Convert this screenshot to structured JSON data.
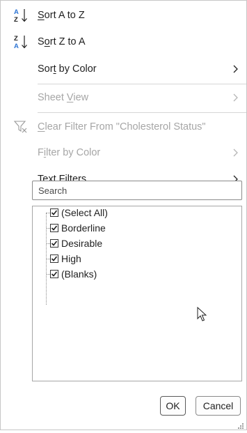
{
  "menu": {
    "sort_az": {
      "pre": "",
      "key": "S",
      "post": "ort A to Z"
    },
    "sort_za": {
      "pre": "S",
      "key": "o",
      "post": "rt Z to A"
    },
    "sort_by_color": {
      "pre": "Sor",
      "key": "t",
      "post": " by Color"
    },
    "sheet_view": {
      "pre": "Sheet ",
      "key": "V",
      "post": "iew"
    },
    "clear_filter": {
      "pre": "",
      "key": "C",
      "post": "lear Filter From \"Cholesterol Status\""
    },
    "filter_by_color": {
      "pre": "F",
      "key": "i",
      "post": "lter by Color"
    },
    "text_filters": {
      "pre": "Text ",
      "key": "F",
      "post": "ilters"
    }
  },
  "search": {
    "placeholder": "Search",
    "value": ""
  },
  "filter_list": {
    "items": [
      {
        "label": "(Select All)",
        "checked": true
      },
      {
        "label": "Borderline",
        "checked": true
      },
      {
        "label": "Desirable",
        "checked": true
      },
      {
        "label": "High",
        "checked": true
      },
      {
        "label": "(Blanks)",
        "checked": true
      }
    ]
  },
  "buttons": {
    "ok": "OK",
    "cancel": "Cancel"
  },
  "icons": {
    "sort_az": "sort-ascending-icon",
    "sort_za": "sort-descending-icon",
    "clear_filter": "clear-filter-icon",
    "submenu": "chevron-right-icon"
  },
  "colors": {
    "accent_blue": "#2e75d4",
    "disabled_text": "#a6a6a6"
  }
}
